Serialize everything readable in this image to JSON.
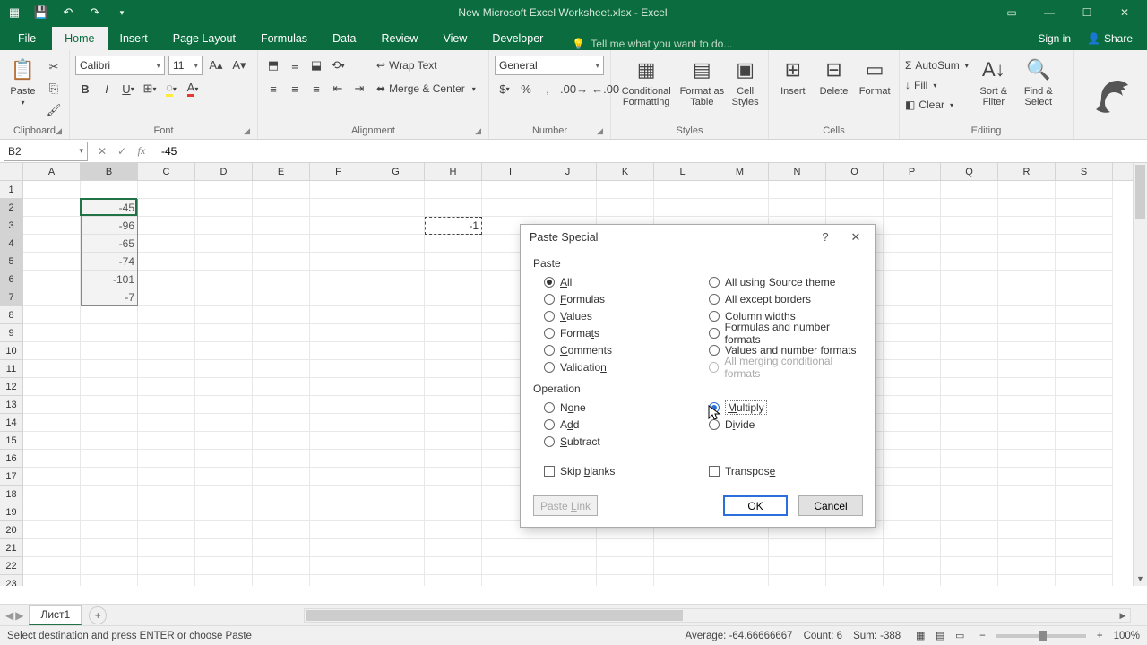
{
  "title": "New Microsoft Excel Worksheet.xlsx - Excel",
  "signin": "Sign in",
  "share": "Share",
  "tellme_placeholder": "Tell me what you want to do...",
  "tabs": {
    "file": "File",
    "list": [
      "Home",
      "Insert",
      "Page Layout",
      "Formulas",
      "Data",
      "Review",
      "View",
      "Developer"
    ],
    "active": "Home"
  },
  "ribbon": {
    "clipboard": {
      "label": "Clipboard",
      "paste": "Paste"
    },
    "font": {
      "label": "Font",
      "name": "Calibri",
      "size": "11"
    },
    "alignment": {
      "label": "Alignment",
      "wrap": "Wrap Text",
      "merge": "Merge & Center"
    },
    "number": {
      "label": "Number",
      "format": "General"
    },
    "styles": {
      "label": "Styles",
      "cond": "Conditional Formatting",
      "fat": "Format as Table",
      "cell": "Cell Styles"
    },
    "cells": {
      "label": "Cells",
      "insert": "Insert",
      "delete": "Delete",
      "format": "Format"
    },
    "editing": {
      "label": "Editing",
      "autosum": "AutoSum",
      "fill": "Fill",
      "clear": "Clear",
      "sort": "Sort & Filter",
      "find": "Find & Select"
    }
  },
  "namebox": "B2",
  "formula": "-45",
  "columns": [
    "A",
    "B",
    "C",
    "D",
    "E",
    "F",
    "G",
    "H",
    "I",
    "J",
    "K",
    "L",
    "M",
    "N",
    "O",
    "P",
    "Q",
    "R",
    "S"
  ],
  "rows": 23,
  "cells": {
    "B2": "-45",
    "B3": "-96",
    "B4": "-65",
    "B5": "-74",
    "B6": "-101",
    "B7": "-7",
    "H3": "-1"
  },
  "selected_range": "B2:B7",
  "cut_range": "H3",
  "sheet_tab": "Лист1",
  "status": {
    "left": "Select destination and press ENTER or choose Paste",
    "avg_label": "Average:",
    "avg": "-64.66666667",
    "count_label": "Count:",
    "count": "6",
    "sum_label": "Sum:",
    "sum": "-388",
    "zoom": "100%"
  },
  "dialog": {
    "title": "Paste Special",
    "paste_label": "Paste",
    "operation_label": "Operation",
    "paste_left": [
      "All",
      "Formulas",
      "Values",
      "Formats",
      "Comments",
      "Validation"
    ],
    "paste_left_accel": [
      "A",
      "F",
      "V",
      "t",
      "C",
      "n"
    ],
    "paste_right": [
      "All using Source theme",
      "All except borders",
      "Column widths",
      "Formulas and number formats",
      "Values and number formats",
      "All merging conditional formats"
    ],
    "paste_selected": "All",
    "paste_disabled": "All merging conditional formats",
    "op_left": [
      "None",
      "Add",
      "Subtract"
    ],
    "op_right": [
      "Multiply",
      "Divide"
    ],
    "op_selected": "Multiply",
    "skip": "Skip blanks",
    "transpose": "Transpose",
    "pastelink": "Paste Link",
    "ok": "OK",
    "cancel": "Cancel"
  }
}
